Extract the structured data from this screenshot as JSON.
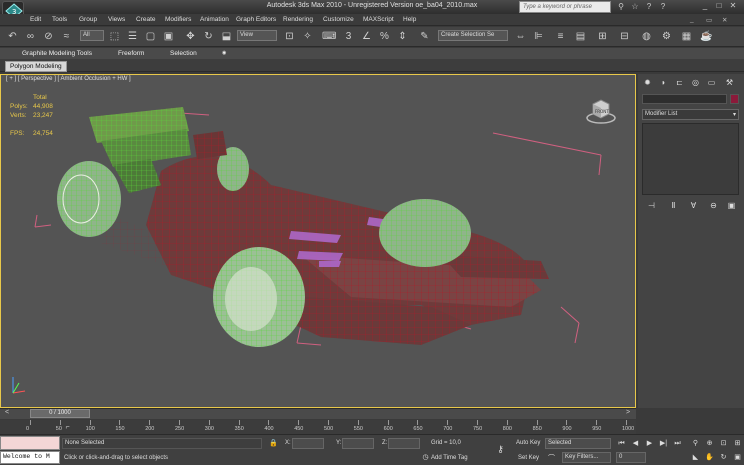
{
  "app": {
    "title": "Autodesk 3ds Max  2010  - Unregistered Version   oe_ba04_2010.max",
    "search_placeholder": "Type a keyword or phrase"
  },
  "menu": [
    "Edit",
    "Tools",
    "Group",
    "Views",
    "Create",
    "Modifiers",
    "Animation",
    "Graph Editors",
    "Rendering",
    "Customize",
    "MAXScript",
    "Help"
  ],
  "toolbar": {
    "selection_filter": "All",
    "ref_coord": "View",
    "selection_set": "Create Selection Se"
  },
  "ribbon": {
    "tabs": [
      "Graphite Modeling Tools",
      "Freeform",
      "Selection"
    ],
    "subtab": "Polygon Modeling"
  },
  "viewport": {
    "label": "[ + ] [ Perspective ] [ Ambient Occlusion + HW ]",
    "stats": {
      "total_label": "Total",
      "polys_label": "Polys:",
      "polys": "44,908",
      "verts_label": "Verts:",
      "verts": "23,247",
      "fps_label": "FPS:",
      "fps": "24,754"
    },
    "viewcube_label": "FRONT"
  },
  "command_panel": {
    "modifier_list": "Modifier List",
    "color": "#8b1a3a"
  },
  "timeline": {
    "slider": "0 / 1000",
    "ticks": [
      "0",
      "50",
      "100",
      "150",
      "200",
      "250",
      "300",
      "350",
      "400",
      "450",
      "500",
      "550",
      "600",
      "650",
      "700",
      "750",
      "800",
      "850",
      "900",
      "950",
      "1000"
    ]
  },
  "status": {
    "maxscript_output": "Welcome to M",
    "selection": "None Selected",
    "prompt": "Click or click-and-drag to select objects",
    "x_label": "X:",
    "y_label": "Y:",
    "z_label": "Z:",
    "grid": "Grid = 10,0",
    "add_time_tag": "Add Time Tag",
    "auto_key": "Auto Key",
    "set_key": "Set Key",
    "key_mode": "Selected",
    "key_filters": "Key Filters...",
    "frame": "0"
  }
}
